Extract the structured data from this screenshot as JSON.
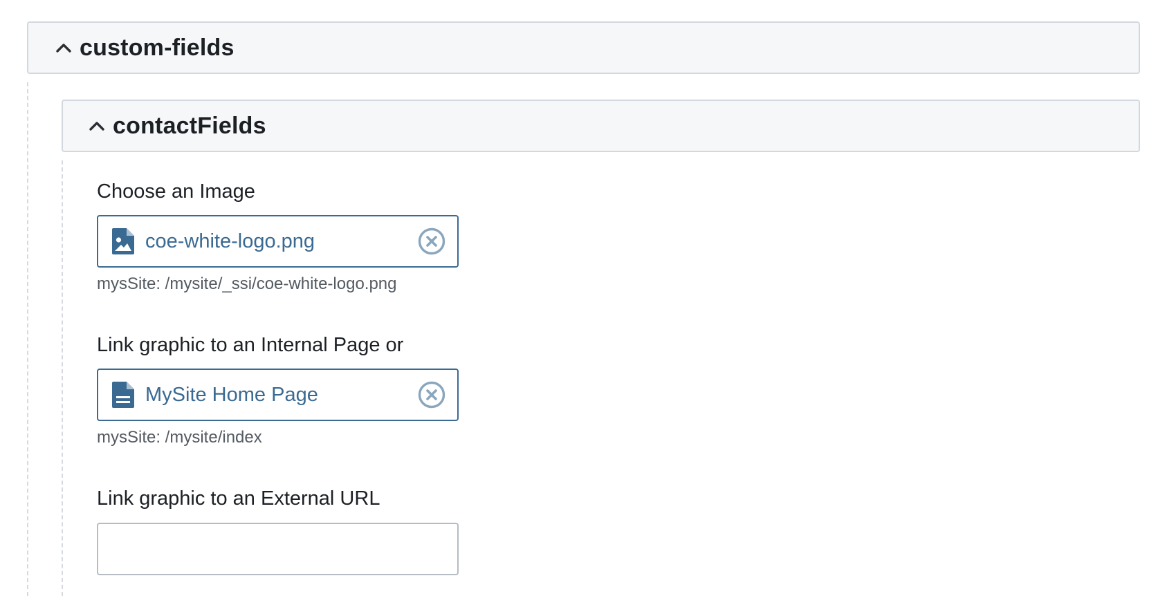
{
  "sections": {
    "outer": {
      "title": "custom-fields",
      "icon": "chevron-up-icon"
    },
    "inner": {
      "title": "contactFields",
      "icon": "chevron-up-icon"
    }
  },
  "fields": {
    "image": {
      "label": "Choose an Image",
      "value": "coe-white-logo.png",
      "path": "mysSite: /mysite/_ssi/coe-white-logo.png",
      "type_icon": "file-image-icon",
      "clear_icon": "clear-circle-icon"
    },
    "internal_link": {
      "label": "Link graphic to an Internal Page or",
      "value": "MySite Home Page",
      "path": "mysSite: /mysite/index",
      "type_icon": "file-page-icon",
      "clear_icon": "clear-circle-icon"
    },
    "external_url": {
      "label": "Link graphic to an External URL",
      "value": "",
      "placeholder": ""
    }
  },
  "colors": {
    "accent": "#3a6a92",
    "header_bg": "#f6f7f9",
    "header_border": "#d3d8de",
    "clear_icon": "#8aa6bd",
    "input_border": "#b5bcc3"
  }
}
